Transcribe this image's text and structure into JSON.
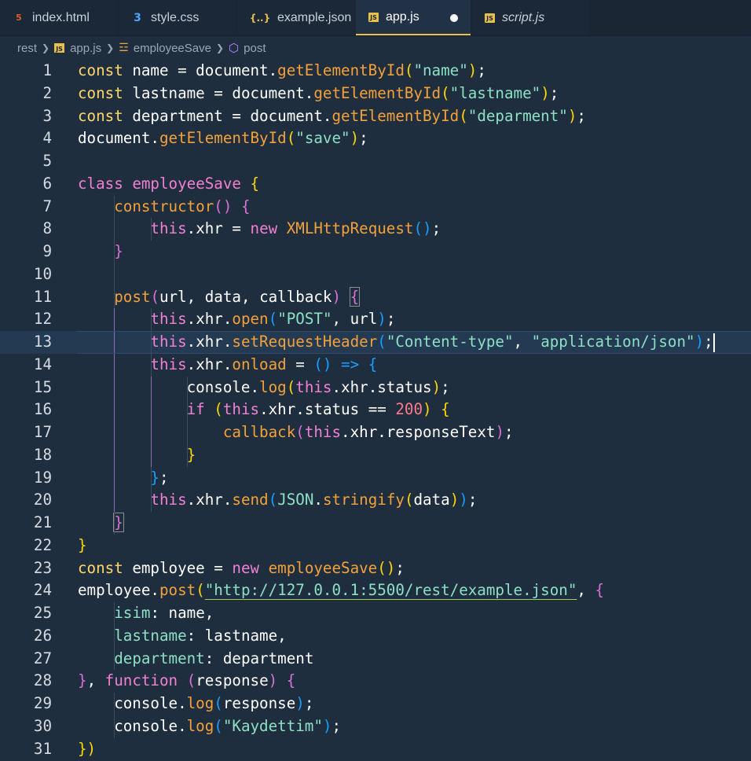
{
  "tabs": [
    {
      "label": "index.html",
      "icon": "html5-icon",
      "active": false
    },
    {
      "label": "style.css",
      "icon": "css3-icon",
      "active": false
    },
    {
      "label": "example.json",
      "icon": "json-braces-icon",
      "active": false
    },
    {
      "label": "app.js",
      "icon": "javascript-icon",
      "active": true,
      "dirty": true
    },
    {
      "label": "script.js",
      "icon": "javascript-icon",
      "active": false
    }
  ],
  "breadcrumb": {
    "folder": "rest",
    "file": "app.js",
    "class": "employeeSave",
    "method": "post"
  },
  "line_numbers": [
    "1",
    "2",
    "3",
    "4",
    "5",
    "6",
    "7",
    "8",
    "9",
    "10",
    "11",
    "12",
    "13",
    "14",
    "15",
    "16",
    "17",
    "18",
    "19",
    "20",
    "21",
    "22",
    "23",
    "24",
    "25",
    "26",
    "27",
    "28",
    "29",
    "30",
    "31"
  ],
  "current_line": 13,
  "colors": {
    "editor_background": "#1f2e3f",
    "tab_active_indicator": "#e8c14a",
    "keyword": "#ffd76a",
    "string": "#8de0c4",
    "function": "#f4a13a",
    "declaration": "#f280d3"
  },
  "code": [
    [
      [
        "kw",
        "const"
      ],
      [
        "plain",
        " name = document."
      ],
      [
        "fn",
        "getElementById"
      ],
      [
        "b1",
        "("
      ],
      [
        "str",
        "\"name\""
      ],
      [
        "b1",
        ")"
      ],
      [
        "plain",
        ";"
      ]
    ],
    [
      [
        "kw",
        "const"
      ],
      [
        "plain",
        " lastname = document."
      ],
      [
        "fn",
        "getElementById"
      ],
      [
        "b1",
        "("
      ],
      [
        "str",
        "\"lastname\""
      ],
      [
        "b1",
        ")"
      ],
      [
        "plain",
        ";"
      ]
    ],
    [
      [
        "kw",
        "const"
      ],
      [
        "plain",
        " department = document."
      ],
      [
        "fn",
        "getElementById"
      ],
      [
        "b1",
        "("
      ],
      [
        "str",
        "\"deparment\""
      ],
      [
        "b1",
        ")"
      ],
      [
        "plain",
        ";"
      ]
    ],
    [
      [
        "plain",
        "document."
      ],
      [
        "fn",
        "getElementById"
      ],
      [
        "b1",
        "("
      ],
      [
        "str",
        "\"save\""
      ],
      [
        "b1",
        ")"
      ],
      [
        "plain",
        ";"
      ]
    ],
    [],
    [
      [
        "def",
        "class"
      ],
      [
        "plain",
        " "
      ],
      [
        "def",
        "employeeSave"
      ],
      [
        "plain",
        " "
      ],
      [
        "b1",
        "{"
      ]
    ],
    [
      [
        "plain",
        "    "
      ],
      [
        "fn",
        "constructor"
      ],
      [
        "b2",
        "()"
      ],
      [
        "plain",
        " "
      ],
      [
        "b2",
        "{"
      ]
    ],
    [
      [
        "plain",
        "        "
      ],
      [
        "def",
        "this"
      ],
      [
        "plain",
        ".xhr = "
      ],
      [
        "def",
        "new"
      ],
      [
        "plain",
        " "
      ],
      [
        "fn",
        "XMLHttpRequest"
      ],
      [
        "b3",
        "()"
      ],
      [
        "plain",
        ";"
      ]
    ],
    [
      [
        "plain",
        "    "
      ],
      [
        "b2",
        "}"
      ]
    ],
    [],
    [
      [
        "plain",
        "    "
      ],
      [
        "fn",
        "post"
      ],
      [
        "b2",
        "("
      ],
      [
        "plain",
        "url, data, callback"
      ],
      [
        "b2",
        ")"
      ],
      [
        "plain",
        " "
      ],
      [
        "b2",
        "{"
      ]
    ],
    [
      [
        "plain",
        "        "
      ],
      [
        "def",
        "this"
      ],
      [
        "plain",
        ".xhr."
      ],
      [
        "fn",
        "open"
      ],
      [
        "b3",
        "("
      ],
      [
        "str",
        "\"POST\""
      ],
      [
        "plain",
        ", url"
      ],
      [
        "b3",
        ")"
      ],
      [
        "plain",
        ";"
      ]
    ],
    [
      [
        "plain",
        "        "
      ],
      [
        "def",
        "this"
      ],
      [
        "plain",
        ".xhr."
      ],
      [
        "fn",
        "setRequestHeader"
      ],
      [
        "b3",
        "("
      ],
      [
        "str",
        "\"Content-type\""
      ],
      [
        "plain",
        ", "
      ],
      [
        "str",
        "\"application/json\""
      ],
      [
        "b3",
        ")"
      ],
      [
        "plain",
        ";"
      ]
    ],
    [
      [
        "plain",
        "        "
      ],
      [
        "def",
        "this"
      ],
      [
        "plain",
        ".xhr."
      ],
      [
        "fn",
        "onload"
      ],
      [
        "plain",
        " = "
      ],
      [
        "b3",
        "()"
      ],
      [
        "plain",
        " "
      ],
      [
        "b3",
        "=>"
      ],
      [
        "plain",
        " "
      ],
      [
        "b3",
        "{"
      ]
    ],
    [
      [
        "plain",
        "            console."
      ],
      [
        "fn",
        "log"
      ],
      [
        "b1",
        "("
      ],
      [
        "def",
        "this"
      ],
      [
        "plain",
        ".xhr.status"
      ],
      [
        "b1",
        ")"
      ],
      [
        "plain",
        ";"
      ]
    ],
    [
      [
        "plain",
        "            "
      ],
      [
        "def",
        "if"
      ],
      [
        "plain",
        " "
      ],
      [
        "b1",
        "("
      ],
      [
        "def",
        "this"
      ],
      [
        "plain",
        ".xhr.status == "
      ],
      [
        "num",
        "200"
      ],
      [
        "b1",
        ")"
      ],
      [
        "plain",
        " "
      ],
      [
        "b1",
        "{"
      ]
    ],
    [
      [
        "plain",
        "                "
      ],
      [
        "fn",
        "callback"
      ],
      [
        "b2",
        "("
      ],
      [
        "def",
        "this"
      ],
      [
        "plain",
        ".xhr.responseText"
      ],
      [
        "b2",
        ")"
      ],
      [
        "plain",
        ";"
      ]
    ],
    [
      [
        "plain",
        "            "
      ],
      [
        "b1",
        "}"
      ]
    ],
    [
      [
        "plain",
        "        "
      ],
      [
        "b3",
        "}"
      ],
      [
        "plain",
        ";"
      ]
    ],
    [
      [
        "plain",
        "        "
      ],
      [
        "def",
        "this"
      ],
      [
        "plain",
        ".xhr."
      ],
      [
        "fn",
        "send"
      ],
      [
        "b3",
        "("
      ],
      [
        "prop",
        "JSON"
      ],
      [
        "plain",
        "."
      ],
      [
        "fn",
        "stringify"
      ],
      [
        "b1",
        "("
      ],
      [
        "plain",
        "data"
      ],
      [
        "b1",
        ")"
      ],
      [
        "b3",
        ")"
      ],
      [
        "plain",
        ";"
      ]
    ],
    [
      [
        "plain",
        "    "
      ],
      [
        "b2",
        "}"
      ]
    ],
    [
      [
        "b1",
        "}"
      ]
    ],
    [
      [
        "kw",
        "const"
      ],
      [
        "plain",
        " employee = "
      ],
      [
        "def",
        "new"
      ],
      [
        "plain",
        " "
      ],
      [
        "fn",
        "employeeSave"
      ],
      [
        "b1",
        "()"
      ],
      [
        "plain",
        ";"
      ]
    ],
    [
      [
        "plain",
        "employee."
      ],
      [
        "fn",
        "post"
      ],
      [
        "b1",
        "("
      ],
      [
        "url",
        "\"http://127.0.0.1:5500/rest/example.json\""
      ],
      [
        "plain",
        ", "
      ],
      [
        "b2",
        "{"
      ]
    ],
    [
      [
        "plain",
        "    "
      ],
      [
        "prop",
        "isim"
      ],
      [
        "plain",
        ": name,"
      ]
    ],
    [
      [
        "plain",
        "    "
      ],
      [
        "prop",
        "lastname"
      ],
      [
        "plain",
        ": lastname,"
      ]
    ],
    [
      [
        "plain",
        "    "
      ],
      [
        "prop",
        "department"
      ],
      [
        "plain",
        ": department"
      ]
    ],
    [
      [
        "b2",
        "}"
      ],
      [
        "plain",
        ", "
      ],
      [
        "def",
        "function"
      ],
      [
        "plain",
        " "
      ],
      [
        "b2",
        "("
      ],
      [
        "plain",
        "response"
      ],
      [
        "b2",
        ")"
      ],
      [
        "plain",
        " "
      ],
      [
        "b2",
        "{"
      ]
    ],
    [
      [
        "plain",
        "    console."
      ],
      [
        "fn",
        "log"
      ],
      [
        "b3",
        "("
      ],
      [
        "plain",
        "response"
      ],
      [
        "b3",
        ")"
      ],
      [
        "plain",
        ";"
      ]
    ],
    [
      [
        "plain",
        "    console."
      ],
      [
        "fn",
        "log"
      ],
      [
        "b3",
        "("
      ],
      [
        "str",
        "\"Kaydettim\""
      ],
      [
        "b3",
        ")"
      ],
      [
        "plain",
        ";"
      ]
    ],
    [
      [
        "b1",
        "})"
      ]
    ]
  ]
}
